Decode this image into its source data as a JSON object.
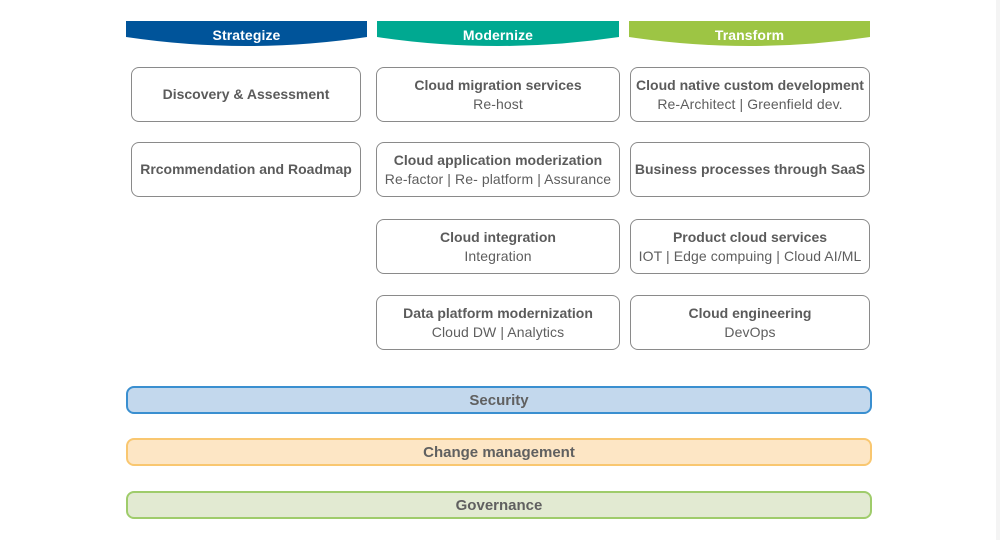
{
  "columns": [
    {
      "title": "Strategize",
      "color": "#00549a",
      "cards": [
        {
          "title": "Discovery & Assessment",
          "subtitle": ""
        },
        {
          "title": "Rrcommendation and Roadmap",
          "subtitle": ""
        }
      ]
    },
    {
      "title": "Modernize",
      "color": "#00a991",
      "cards": [
        {
          "title": "Cloud migration services",
          "subtitle": "Re-host"
        },
        {
          "title": "Cloud application moderization",
          "subtitle": "Re-factor | Re- platform | Assurance"
        },
        {
          "title": "Cloud integration",
          "subtitle": "Integration"
        },
        {
          "title": "Data platform modernization",
          "subtitle": "Cloud DW | Analytics"
        }
      ]
    },
    {
      "title": "Transform",
      "color": "#9dc544",
      "cards": [
        {
          "title": "Cloud native custom development",
          "subtitle": "Re-Architect | Greenfield dev."
        },
        {
          "title": "Business processes through SaaS",
          "subtitle": ""
        },
        {
          "title": "Product cloud services",
          "subtitle": "IOT | Edge compuing | Cloud AI/ML"
        },
        {
          "title": "Cloud engineering",
          "subtitle": "DevOps"
        }
      ]
    }
  ],
  "bands": [
    {
      "label": "Security",
      "fill": "#c3d8ed",
      "border": "#3a8fd0"
    },
    {
      "label": "Change management",
      "fill": "#fde6c5",
      "border": "#f9c770"
    },
    {
      "label": "Governance",
      "fill": "#e2ead2",
      "border": "#9fcc6b"
    }
  ]
}
